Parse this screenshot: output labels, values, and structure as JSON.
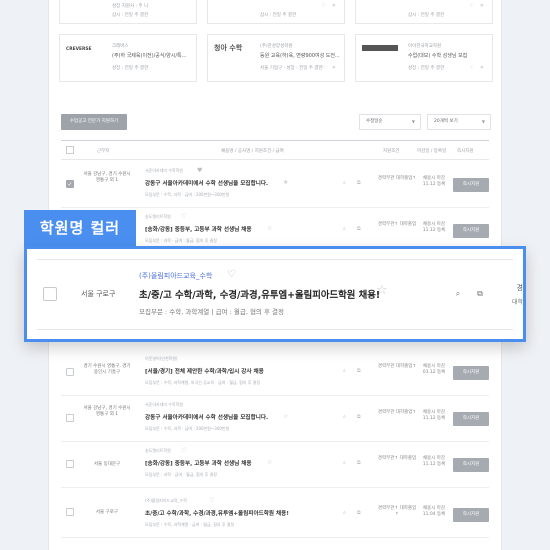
{
  "top_cards": [
    {
      "logo": "",
      "line1": "성장 지원사 : 주 니",
      "line2": "",
      "line3": "삼시 : 전일 주 결한"
    },
    {
      "logo": "",
      "line1": "삼시 : 전일 주 결한",
      "line2": "",
      "line3": ""
    },
    {
      "logo": "",
      "line1": "삼시 : 전일 주 결한",
      "line2": "",
      "line3": ""
    }
  ],
  "company_cards": [
    {
      "logo": "CREVERSE",
      "line1": "크레버스",
      "line2": "(주)하 국제육(이전)/공식/양시/특...",
      "line3": "성장 : 전일 주 결한"
    },
    {
      "logo": "청아 수학",
      "line1": "(주)한성양성학원",
      "line2": "등원 교육(하)육, 면량900여성 도전...",
      "line3": "서울 기업구 · 성장 : 전일 주 결한"
    },
    {
      "logo": "",
      "line1": "아이한국학교학원",
      "line2": "수업(대보) 수학 성생님 모집",
      "line3": "성장 : 전일 주 결한"
    }
  ],
  "filter": {
    "button": "수업공고 전문가 지원하기",
    "sort": "수정일순",
    "per_page": "20개씩 보기"
  },
  "table_headers": {
    "location": "근무지",
    "info": "채용명 / 공사명 / 지원조건 / 급여",
    "condition": "지원조건",
    "due": "마감일 / 등록일",
    "apply": "즉시지원"
  },
  "rows_top": [
    {
      "loc": "서울 강남구, 경기 수원시 영통구 외 1",
      "org": "서준아카데미 수학학원",
      "title": "강동구 서울아카데미에서 수학 선생님을 모집합니다.",
      "meta": "모집부문 : 수학, 과학 · 급여 : 200만원~300만원",
      "cond": "경력무관 대학졸업↑",
      "due": "채용시 마감 11.12 등록",
      "apply": "즉시지원",
      "checked": true
    },
    {
      "loc": "서울 동대문구",
      "org": "송도엘리트학원",
      "title": "[송화/강동] 중등부, 고등부 과학 선생님 채용",
      "meta": "모집부문 : 과학 · 급여 : 월급, 협의 후 결정",
      "cond": "경력무관↑ 대학졸업",
      "due": "채용시 마감 11.12 등록",
      "apply": "즉시지원",
      "checked": false
    }
  ],
  "highlight": {
    "tag": "학원명 컬러",
    "location": "서울 구로구",
    "org": "(주)올림피아드교육_수학",
    "title": "초/중/고 수학/과학, 수경/과경,유투엠+올림피아드학원 채용!",
    "meta": "모집부문 : 수학, 과학계열  |  급여 : 월급, 협의 후 결정",
    "right1": "경",
    "right2": "대학"
  },
  "rows_bottom": [
    {
      "loc": "경기 수원시 영통구, 경기 용인시 기흥구",
      "org": "이웃영어(인천학원)",
      "title": "[서울/경기] 전체 제안한 수학/과학/입시 강사 채용",
      "meta": "모집부문 : 수학, 과학계열, 외국인 공교육 · 급여 : 월급, 협의 후 결정",
      "cond": "경력무관 대학졸업↑",
      "due": "채용시 마감 03.12 등록",
      "apply": "즉시지원",
      "checked": false
    },
    {
      "loc": "서울 강남구, 경기 수원시 영통구 외 1",
      "org": "서준아카데미 수학학원",
      "title": "강동구 서울아카데미에서 수학 선생님을 모집합니다.",
      "meta": "모집부문 : 수학, 과학 · 급여 : 200만원~300만원",
      "cond": "경력무관 대학졸업↑",
      "due": "채용시 마감 11.12 등록",
      "apply": "즉시지원",
      "checked": false
    },
    {
      "loc": "서울 동대문구",
      "org": "송도엘리트학원",
      "title": "[송화/강동] 중등부, 고등부 과학 선생님 채용",
      "meta": "모집부문 : 과학 · 급여 : 월급, 협의 후 결정",
      "cond": "경력무관↑ 대학졸업",
      "due": "채용시 마감 11.12 등록",
      "apply": "즉시지원",
      "checked": false
    },
    {
      "loc": "서울 구로구",
      "org": "(주)올림피아드교육_수학",
      "title": "초/중/고 수학/과학, 수경/과경,유투엠+올림피아드학원 채용!",
      "meta": "모집부문 : 수학, 과학계열 · 급여 : 월급, 협의 후 결정",
      "cond": "경력무관↑ 대학졸업↑",
      "due": "채용시 마감 11.04 등록",
      "apply": "즉시지원",
      "checked": false
    }
  ],
  "colors": {
    "accent": "#4a8ff0",
    "org_link": "#4a6fdc",
    "apply_bg": "#a6abb1"
  }
}
